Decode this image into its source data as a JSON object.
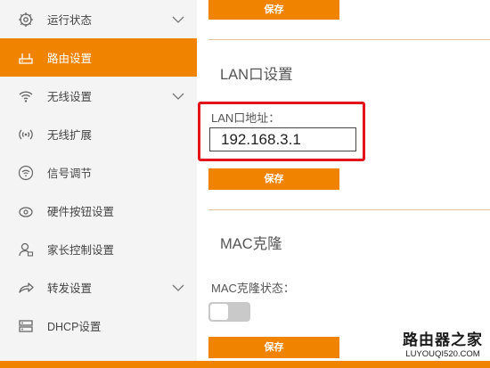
{
  "sidebar": {
    "items": [
      {
        "label": "运行状态",
        "icon": "gear-icon",
        "expandable": true,
        "active": false
      },
      {
        "label": "路由设置",
        "icon": "router-icon",
        "expandable": false,
        "active": true
      },
      {
        "label": "无线设置",
        "icon": "wifi-icon",
        "expandable": true,
        "active": false
      },
      {
        "label": "无线扩展",
        "icon": "signal-extend-icon",
        "expandable": false,
        "active": false
      },
      {
        "label": "信号调节",
        "icon": "signal-adjust-icon",
        "expandable": false,
        "active": false
      },
      {
        "label": "硬件按钮设置",
        "icon": "power-button-icon",
        "expandable": false,
        "active": false
      },
      {
        "label": "家长控制设置",
        "icon": "parental-user-icon",
        "expandable": false,
        "active": false
      },
      {
        "label": "转发设置",
        "icon": "forward-arrow-icon",
        "expandable": true,
        "active": false
      },
      {
        "label": "DHCP设置",
        "icon": "server-icon",
        "expandable": false,
        "active": false
      }
    ]
  },
  "main": {
    "save_top_label": "保存",
    "lan": {
      "title": "LAN口设置",
      "address_label": "LAN口地址：",
      "address_value": "192.168.3.1",
      "save_label": "保存"
    },
    "mac": {
      "title": "MAC克隆",
      "status_label": "MAC克隆状态：",
      "enabled": false,
      "save_label": "保存"
    }
  },
  "watermark": {
    "main": "路由器之家",
    "sub": "LUYOUQI520.COM"
  },
  "colors": {
    "accent": "#f08400",
    "highlight": "#e5141a",
    "sidebar_bg": "#f4f4f4"
  }
}
